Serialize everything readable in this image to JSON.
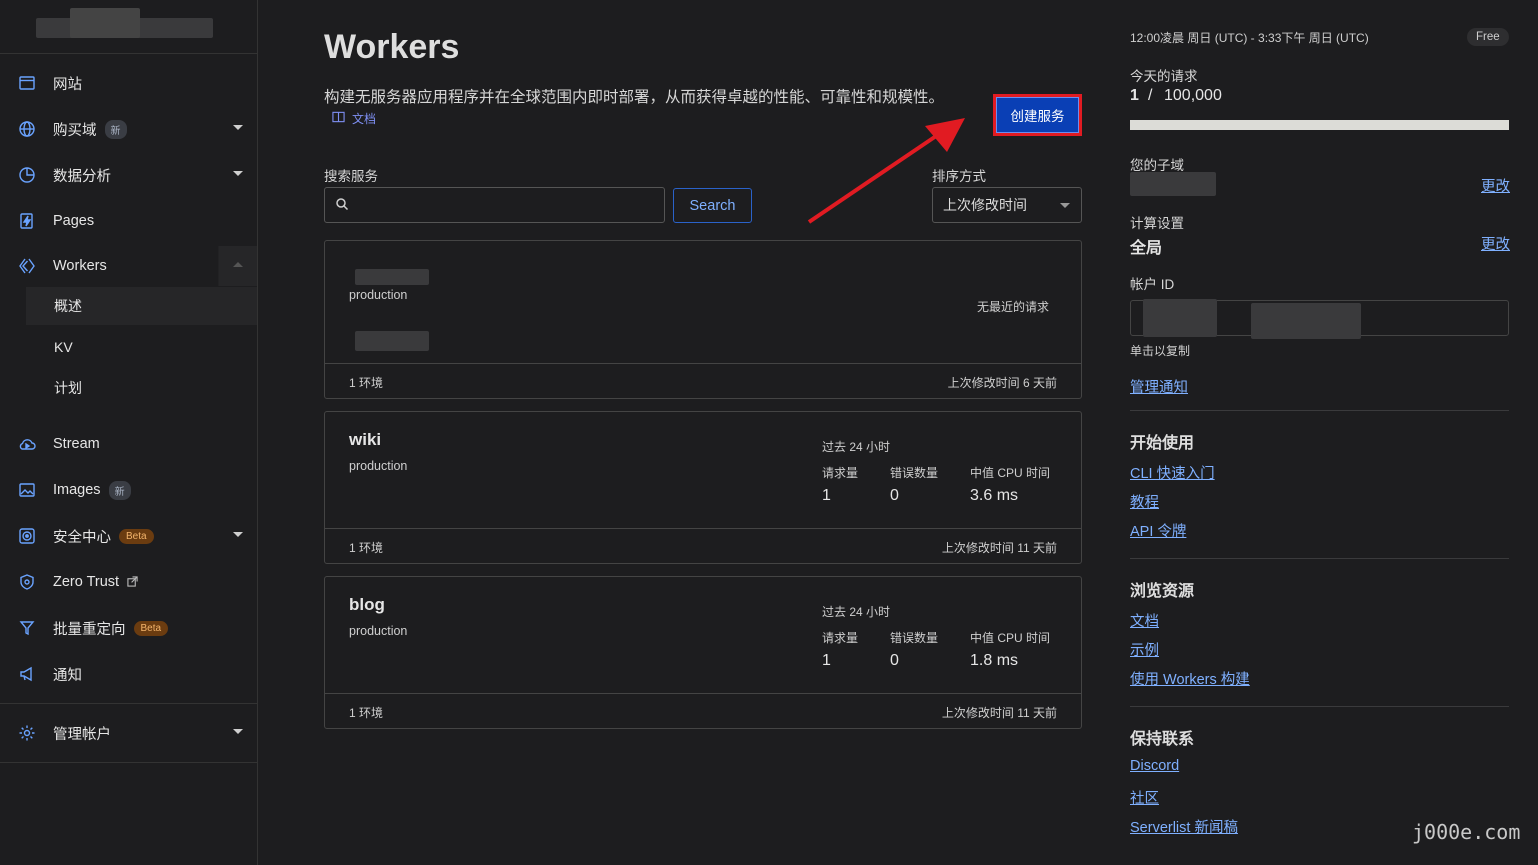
{
  "sidebar": {
    "items": [
      {
        "label": "网站"
      },
      {
        "label": "购买域",
        "badge": "新"
      },
      {
        "label": "数据分析"
      },
      {
        "label": "Pages"
      },
      {
        "label": "Workers"
      },
      {
        "label": "Stream"
      },
      {
        "label": "Images",
        "badge": "新"
      },
      {
        "label": "安全中心",
        "badge": "Beta"
      },
      {
        "label": "Zero Trust"
      },
      {
        "label": "批量重定向",
        "badge": "Beta"
      },
      {
        "label": "通知"
      },
      {
        "label": "管理帐户"
      }
    ],
    "workers_sub": [
      {
        "label": "概述"
      },
      {
        "label": "KV"
      },
      {
        "label": "计划"
      }
    ]
  },
  "main": {
    "title": "Workers",
    "description": "构建无服务器应用程序并在全球范围内即时部署，从而获得卓越的性能、可靠性和规模性。",
    "docs_link": "文档",
    "create_button": "创建服务",
    "search_label": "搜索服务",
    "search_placeholder": "",
    "search_button": "Search",
    "sort_label": "排序方式",
    "sort_value": "上次修改时间",
    "services": [
      {
        "name": "",
        "env": "production",
        "no_requests": "无最近的请求",
        "env_count": "1 环境",
        "modified": "上次修改时间 6 天前"
      },
      {
        "name": "wiki",
        "env": "production",
        "stats_title": "过去 24 小时",
        "requests_label": "请求量",
        "requests": "1",
        "errors_label": "错误数量",
        "errors": "0",
        "cpu_label": "中值 CPU 时间",
        "cpu": "3.6 ms",
        "env_count": "1 环境",
        "modified": "上次修改时间 11 天前"
      },
      {
        "name": "blog",
        "env": "production",
        "stats_title": "过去 24 小时",
        "requests_label": "请求量",
        "requests": "1",
        "errors_label": "错误数量",
        "errors": "0",
        "cpu_label": "中值 CPU 时间",
        "cpu": "1.8 ms",
        "env_count": "1 环境",
        "modified": "上次修改时间 11 天前"
      }
    ]
  },
  "right": {
    "time_range": "12:00凌晨 周日 (UTC) - 3:33下午 周日 (UTC)",
    "plan_badge": "Free",
    "requests_label": "今天的请求",
    "requests_used": "1",
    "requests_sep": "/",
    "requests_limit": "100,000",
    "requests_fraction": 1e-05,
    "subdomain_label": "您的子域",
    "change_link": "更改",
    "compute_label": "计算设置",
    "compute_value": "全局",
    "account_id_label": "帐户 ID",
    "copy_hint": "单击以复制",
    "manage_notifications": "管理通知",
    "getting_started": {
      "title": "开始使用",
      "links": [
        "CLI 快速入门",
        "教程",
        "API 令牌"
      ]
    },
    "browse": {
      "title": "浏览资源",
      "links": [
        "文档",
        "示例",
        "使用 Workers 构建"
      ]
    },
    "contact": {
      "title": "保持联系",
      "links": [
        "Discord",
        "社区",
        "Serverlist 新闻稿"
      ]
    }
  },
  "watermark": "j000e.com",
  "colors": {
    "accent": "#0a3fb5",
    "link": "#7fb0ff",
    "highlight_border": "#e11b22",
    "beta_badge": "#6b3c10"
  }
}
